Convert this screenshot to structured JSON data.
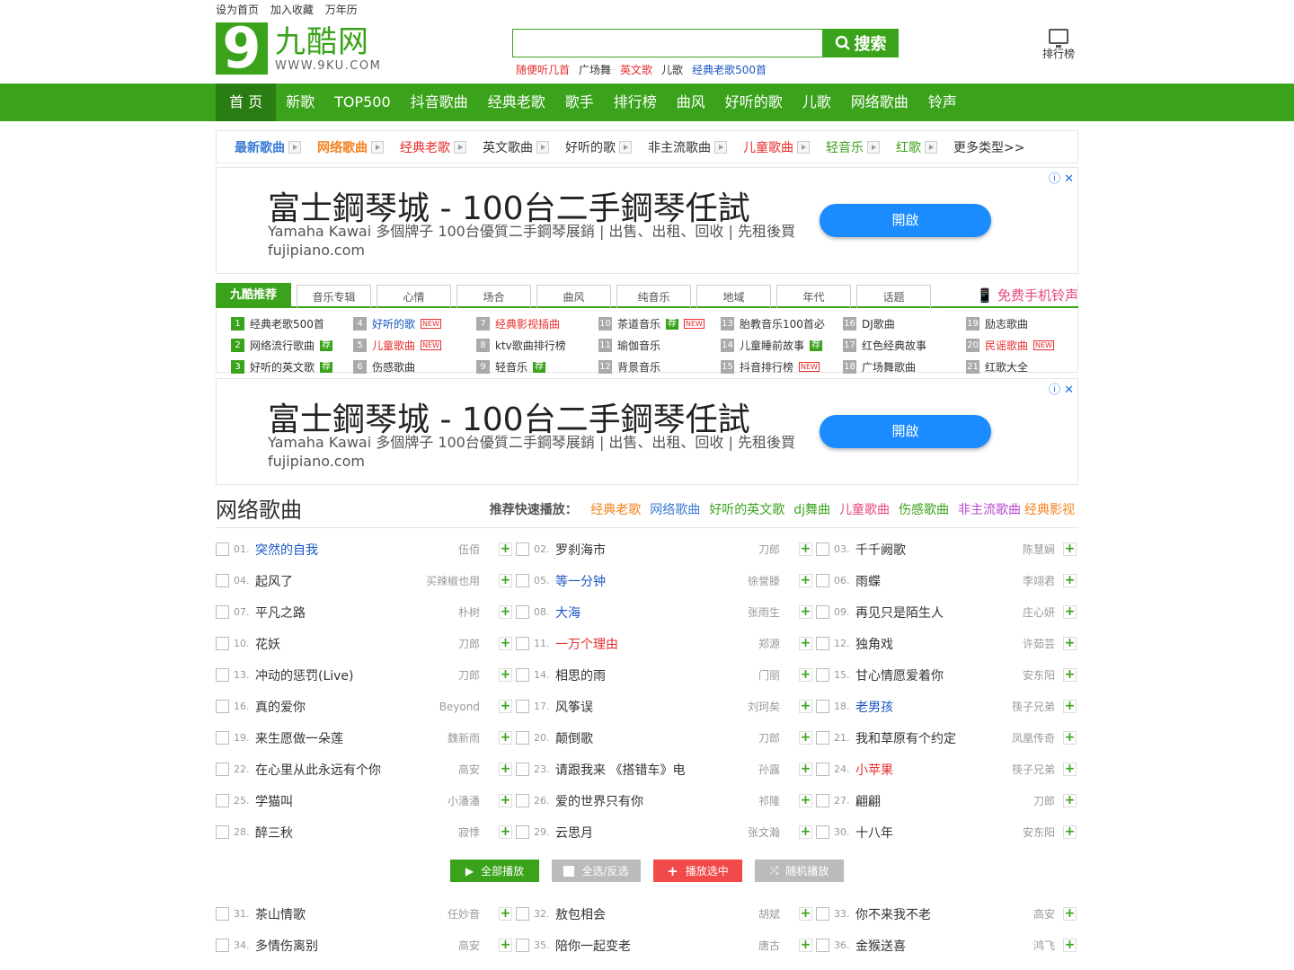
{
  "toplinks": [
    "设为首页",
    "加入收藏",
    "万年历"
  ],
  "logo": {
    "digit": "9",
    "cn": "九酷网",
    "en": "WWW.9KU.COM"
  },
  "search": {
    "placeholder": "",
    "button": "搜索",
    "tags": [
      {
        "text": "随便听几首",
        "color": "#e82d2d"
      },
      {
        "text": "广场舞",
        "color": "#333333"
      },
      {
        "text": "英文歌",
        "color": "#e82d2d"
      },
      {
        "text": "儿歌",
        "color": "#333333"
      },
      {
        "text": "经典老歌500首",
        "color": "#1a56c4"
      }
    ]
  },
  "rank_label": "排行榜",
  "nav": [
    "首 页",
    "新歌",
    "TOP500",
    "抖音歌曲",
    "经典老歌",
    "歌手",
    "排行榜",
    "曲风",
    "好听的歌",
    "儿歌",
    "网络歌曲",
    "铃声"
  ],
  "types": [
    {
      "text": "最新歌曲",
      "color": "#3a7bd5",
      "bold": true
    },
    {
      "text": "网络歌曲",
      "color": "#f5821f",
      "bold": true
    },
    {
      "text": "经典老歌",
      "color": "#e82d2d",
      "bold": false
    },
    {
      "text": "英文歌曲",
      "color": "#333333",
      "bold": false
    },
    {
      "text": "好听的歌",
      "color": "#333333",
      "bold": false
    },
    {
      "text": "非主流歌曲",
      "color": "#333333",
      "bold": false
    },
    {
      "text": "儿童歌曲",
      "color": "#e82d2d",
      "bold": false
    },
    {
      "text": "轻音乐",
      "color": "#3aa31b",
      "bold": false
    },
    {
      "text": "红歌",
      "color": "#3aa31b",
      "bold": false
    }
  ],
  "types_more": "更多类型>>",
  "ad": {
    "title": "富士鋼琴城 - 100台二手鋼琴任試",
    "desc": "Yamaha Kawai 多個牌子 100台優質二手鋼琴展銷 | 出售、出租、回收 | 先租後買 fujipiano.com",
    "button": "開啟",
    "close": "ⓘ ✕"
  },
  "rec": {
    "main_tab": "九酷推荐",
    "tabs": [
      "音乐专辑",
      "心情",
      "场合",
      "曲风",
      "纯音乐",
      "地域",
      "年代",
      "话题"
    ],
    "ringtone": "免费手机铃声",
    "items": [
      {
        "n": "1",
        "text": "经典老歌500首",
        "color": "#333333",
        "badge": "",
        "g": true
      },
      {
        "n": "4",
        "text": "好听的歌",
        "color": "#1a56c4",
        "badge": "NEW",
        "g": false
      },
      {
        "n": "7",
        "text": "经典影视插曲",
        "color": "#e82d2d",
        "badge": "",
        "g": false
      },
      {
        "n": "10",
        "text": "茶道音乐",
        "color": "#333333",
        "badge": "荐NEW",
        "g": false
      },
      {
        "n": "13",
        "text": "胎教音乐100首必",
        "color": "#333333",
        "badge": "",
        "g": false
      },
      {
        "n": "16",
        "text": "DJ歌曲",
        "color": "#333333",
        "badge": "",
        "g": false
      },
      {
        "n": "19",
        "text": "励志歌曲",
        "color": "#333333",
        "badge": "",
        "g": false
      },
      {
        "n": "2",
        "text": "网络流行歌曲",
        "color": "#333333",
        "badge": "荐",
        "g": true
      },
      {
        "n": "5",
        "text": "儿童歌曲",
        "color": "#e82d2d",
        "badge": "NEW",
        "g": false
      },
      {
        "n": "8",
        "text": "ktv歌曲排行榜",
        "color": "#333333",
        "badge": "",
        "g": false
      },
      {
        "n": "11",
        "text": "瑜伽音乐",
        "color": "#333333",
        "badge": "",
        "g": false
      },
      {
        "n": "14",
        "text": "儿童睡前故事",
        "color": "#333333",
        "badge": "荐",
        "g": false
      },
      {
        "n": "17",
        "text": "红色经典故事",
        "color": "#333333",
        "badge": "",
        "g": false
      },
      {
        "n": "20",
        "text": "民谣歌曲",
        "color": "#e82d2d",
        "badge": "NEW",
        "g": false
      },
      {
        "n": "3",
        "text": "好听的英文歌",
        "color": "#333333",
        "badge": "荐",
        "g": true
      },
      {
        "n": "6",
        "text": "伤感歌曲",
        "color": "#333333",
        "badge": "",
        "g": false
      },
      {
        "n": "9",
        "text": "轻音乐",
        "color": "#333333",
        "badge": "荐",
        "g": false
      },
      {
        "n": "12",
        "text": "背景音乐",
        "color": "#333333",
        "badge": "",
        "g": false
      },
      {
        "n": "15",
        "text": "抖音排行榜",
        "color": "#333333",
        "badge": "NEW",
        "g": false
      },
      {
        "n": "18",
        "text": "广场舞歌曲",
        "color": "#333333",
        "badge": "",
        "g": false
      },
      {
        "n": "21",
        "text": "红歌大全",
        "color": "#333333",
        "badge": "",
        "g": false
      }
    ]
  },
  "section": {
    "title": "网络歌曲",
    "quick_label": "推荐快速播放：",
    "quick": [
      {
        "text": "经典老歌",
        "color": "#f5821f"
      },
      {
        "text": "网络歌曲",
        "color": "#3a7bd5"
      },
      {
        "text": "好听的英文歌",
        "color": "#3aa31b"
      },
      {
        "text": "dj舞曲",
        "color": "#3aa31b"
      },
      {
        "text": "儿童歌曲",
        "color": "#e84a7a"
      },
      {
        "text": "伤感歌曲",
        "color": "#3aa31b"
      },
      {
        "text": "非主流歌曲",
        "color": "#b84ad0"
      },
      {
        "text": "经典影视",
        "color": "#f5821f"
      }
    ]
  },
  "songs": [
    {
      "n": "01.",
      "title": "突然的自我",
      "singer": "伍佰",
      "color": "#1a56c4"
    },
    {
      "n": "02.",
      "title": "罗刹海市",
      "singer": "刀郎",
      "color": "#333333"
    },
    {
      "n": "03.",
      "title": "千千阙歌",
      "singer": "陈慧娴",
      "color": "#333333"
    },
    {
      "n": "04.",
      "title": "起风了",
      "singer": "买辣椒也用",
      "color": "#333333"
    },
    {
      "n": "05.",
      "title": "等一分钟",
      "singer": "徐誉滕",
      "color": "#1a56c4"
    },
    {
      "n": "06.",
      "title": "雨蝶",
      "singer": "李翊君",
      "color": "#333333"
    },
    {
      "n": "07.",
      "title": "平凡之路",
      "singer": "朴树",
      "color": "#333333"
    },
    {
      "n": "08.",
      "title": "大海",
      "singer": "张雨生",
      "color": "#1a56c4"
    },
    {
      "n": "09.",
      "title": "再见只是陌生人",
      "singer": "庄心妍",
      "color": "#333333"
    },
    {
      "n": "10.",
      "title": "花妖",
      "singer": "刀郎",
      "color": "#333333"
    },
    {
      "n": "11.",
      "title": "一万个理由",
      "singer": "郑源",
      "color": "#e82d2d"
    },
    {
      "n": "12.",
      "title": "独角戏",
      "singer": "许茹芸",
      "color": "#333333"
    },
    {
      "n": "13.",
      "title": "冲动的惩罚(Live)",
      "singer": "刀郎",
      "color": "#333333"
    },
    {
      "n": "14.",
      "title": "相思的雨",
      "singer": "门丽",
      "color": "#333333"
    },
    {
      "n": "15.",
      "title": "甘心情愿爱着你",
      "singer": "安东阳",
      "color": "#333333"
    },
    {
      "n": "16.",
      "title": "真的爱你",
      "singer": "Beyond",
      "color": "#333333"
    },
    {
      "n": "17.",
      "title": "风筝误",
      "singer": "刘珂矣",
      "color": "#333333"
    },
    {
      "n": "18.",
      "title": "老男孩",
      "singer": "筷子兄弟",
      "color": "#1a56c4"
    },
    {
      "n": "19.",
      "title": "来生愿做一朵莲",
      "singer": "魏新雨",
      "color": "#333333"
    },
    {
      "n": "20.",
      "title": "颠倒歌",
      "singer": "刀郎",
      "color": "#333333"
    },
    {
      "n": "21.",
      "title": "我和草原有个约定",
      "singer": "凤凰传奇",
      "color": "#333333"
    },
    {
      "n": "22.",
      "title": "在心里从此永远有个你",
      "singer": "高安",
      "color": "#333333"
    },
    {
      "n": "23.",
      "title": "请跟我来 《搭错车》电",
      "singer": "孙露",
      "color": "#333333"
    },
    {
      "n": "24.",
      "title": "小苹果",
      "singer": "筷子兄弟",
      "color": "#e82d2d"
    },
    {
      "n": "25.",
      "title": "学猫叫",
      "singer": "小潘潘",
      "color": "#333333"
    },
    {
      "n": "26.",
      "title": "爱的世界只有你",
      "singer": "祁隆",
      "color": "#333333"
    },
    {
      "n": "27.",
      "title": "翩翩",
      "singer": "刀郎",
      "color": "#333333"
    },
    {
      "n": "28.",
      "title": "醉三秋",
      "singer": "寂悸",
      "color": "#333333"
    },
    {
      "n": "29.",
      "title": "云思月",
      "singer": "张文瀚",
      "color": "#333333"
    },
    {
      "n": "30.",
      "title": "十八年",
      "singer": "安东阳",
      "color": "#333333"
    }
  ],
  "buttons": {
    "play_all": "全部播放",
    "select": "全选/反选",
    "play_selected": "播放选中",
    "random": "随机播放"
  },
  "songs2": [
    {
      "n": "31.",
      "title": "茶山情歌",
      "singer": "任妙音",
      "color": "#333333"
    },
    {
      "n": "32.",
      "title": "敖包相会",
      "singer": "胡斌",
      "color": "#333333"
    },
    {
      "n": "33.",
      "title": "你不来我不老",
      "singer": "高安",
      "color": "#333333"
    },
    {
      "n": "34.",
      "title": "多情伤离别",
      "singer": "高安",
      "color": "#333333"
    },
    {
      "n": "35.",
      "title": "陪你一起变老",
      "singer": "唐古",
      "color": "#333333"
    },
    {
      "n": "36.",
      "title": "金猴送喜",
      "singer": "鸿飞",
      "color": "#333333"
    }
  ]
}
